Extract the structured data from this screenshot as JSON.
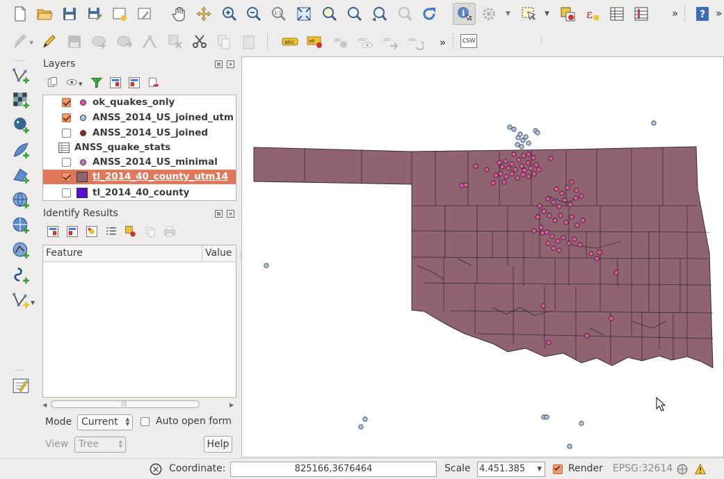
{
  "layers_panel": {
    "title": "Layers",
    "items": [
      {
        "name": "ok_quakes_only",
        "checked": true,
        "symbol": "dot",
        "color": "#e0569f"
      },
      {
        "name": "ANSS_2014_US_joined_utm",
        "checked": true,
        "symbol": "dot",
        "color": "#a9c6e4"
      },
      {
        "name": "ANSS_2014_US_joined",
        "checked": false,
        "symbol": "dot",
        "color": "#8a2431"
      },
      {
        "name": "ANSS_quake_stats",
        "checked": null,
        "symbol": "table",
        "color": ""
      },
      {
        "name": "ANSS_2014_US_minimal",
        "checked": null,
        "symbol": "dot",
        "color": "#c173b3"
      },
      {
        "name": "tl_2014_40_county_utm14",
        "checked": true,
        "symbol": "fill",
        "color": "#906370",
        "selected": true
      },
      {
        "name": "tl_2014_40_county",
        "checked": false,
        "symbol": "fill",
        "color": "#5a0ed6"
      }
    ]
  },
  "identify_panel": {
    "title": "Identify Results",
    "columns": [
      "Feature",
      "Value"
    ],
    "mode_label": "Mode",
    "mode_value": "Current",
    "auto_open_label": "Auto open form",
    "view_label": "View",
    "view_value": "Tree",
    "help_label": "Help"
  },
  "statusbar": {
    "coordinate_label": "Coordinate:",
    "coordinate_value": "825166,3676464",
    "scale_label": "Scale",
    "scale_value": "4.451.385",
    "render_label": "Render",
    "crs": "EPSG:32614"
  },
  "toolbar": {
    "overflow": "»",
    "csw_label": "CSW",
    "abc_label": "abc",
    "help_label": "?"
  },
  "map": {
    "background": "#ffffff",
    "polygon_fill": "#906370",
    "quake_color": "#e0569f",
    "outside_quake_color": "#a9c6e4"
  }
}
